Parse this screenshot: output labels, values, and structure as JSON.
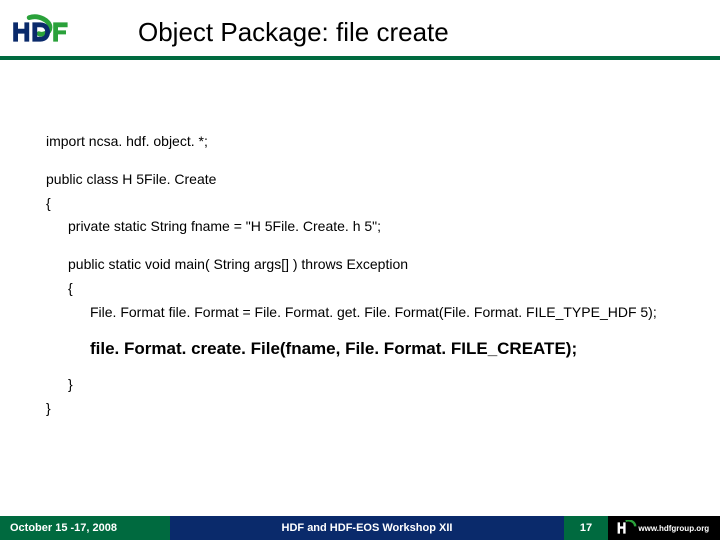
{
  "header": {
    "title": "Object Package: file create"
  },
  "code": {
    "import": "import ncsa. hdf. object. *;",
    "class_decl": "public class H 5File. Create",
    "open_brace": "{",
    "field": "private static String fname = \"H 5File. Create. h 5\";",
    "main_decl": "public static void main( String args[] ) throws Exception",
    "main_open": "{",
    "fileformat": "File. Format file. Format = File. Format. get. File. Format(File. Format. FILE_TYPE_HDF 5);",
    "create_call": "file. Format. create. File(fname, File. Format. FILE_CREATE);",
    "main_close": "}",
    "class_close": "}"
  },
  "footer": {
    "date": "October 15 -17, 2008",
    "workshop": "HDF and HDF-EOS Workshop XII",
    "page": "17",
    "org": "www.hdfgroup.org"
  }
}
